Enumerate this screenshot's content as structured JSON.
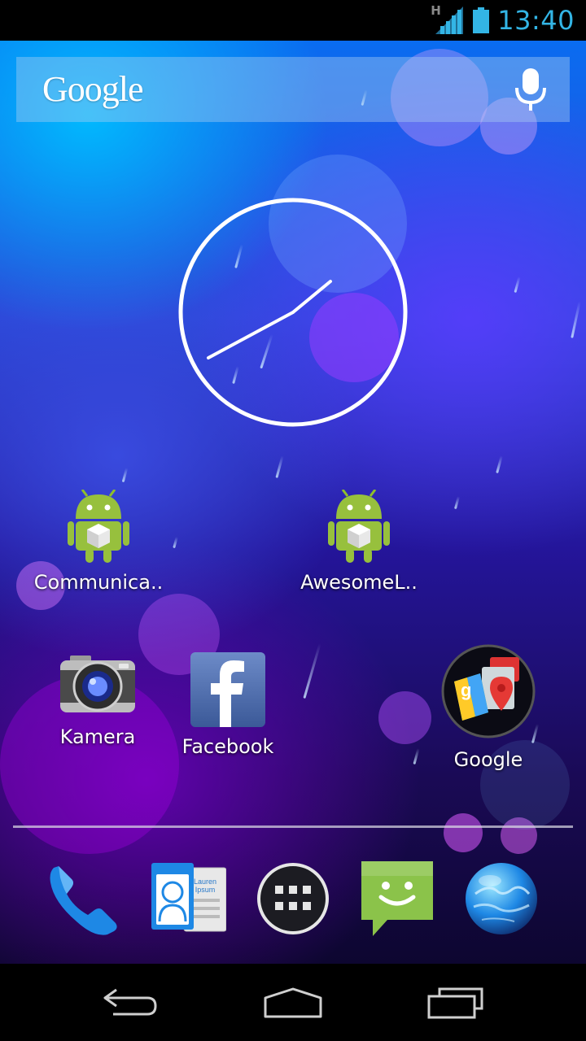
{
  "status_bar": {
    "time": "13:40",
    "network_type": "H",
    "icons": [
      "network-type-icon",
      "signal-icon",
      "battery-icon"
    ],
    "accent_color": "#33b5e5"
  },
  "search_widget": {
    "logo_text": "Google",
    "icons": [
      "microphone-icon"
    ]
  },
  "clock_widget": {
    "type": "analog",
    "time": "13:40"
  },
  "shortcuts": [
    {
      "label": "Communica..",
      "icon": "android-app-icon"
    },
    {
      "label": "AwesomeL..",
      "icon": "android-app-icon"
    },
    {
      "label": "Kamera",
      "icon": "camera-icon"
    },
    {
      "label": "Facebook",
      "icon": "facebook-icon"
    },
    {
      "label": "Google",
      "icon": "google-folder-icon"
    }
  ],
  "dock": {
    "items": [
      "phone-icon",
      "contacts-icon",
      "app-drawer-icon",
      "messaging-icon",
      "browser-icon"
    ],
    "contacts_card_text": "Lauren Ipsum"
  },
  "navigation_bar": {
    "buttons": [
      "back-icon",
      "home-icon",
      "recent-apps-icon"
    ]
  }
}
